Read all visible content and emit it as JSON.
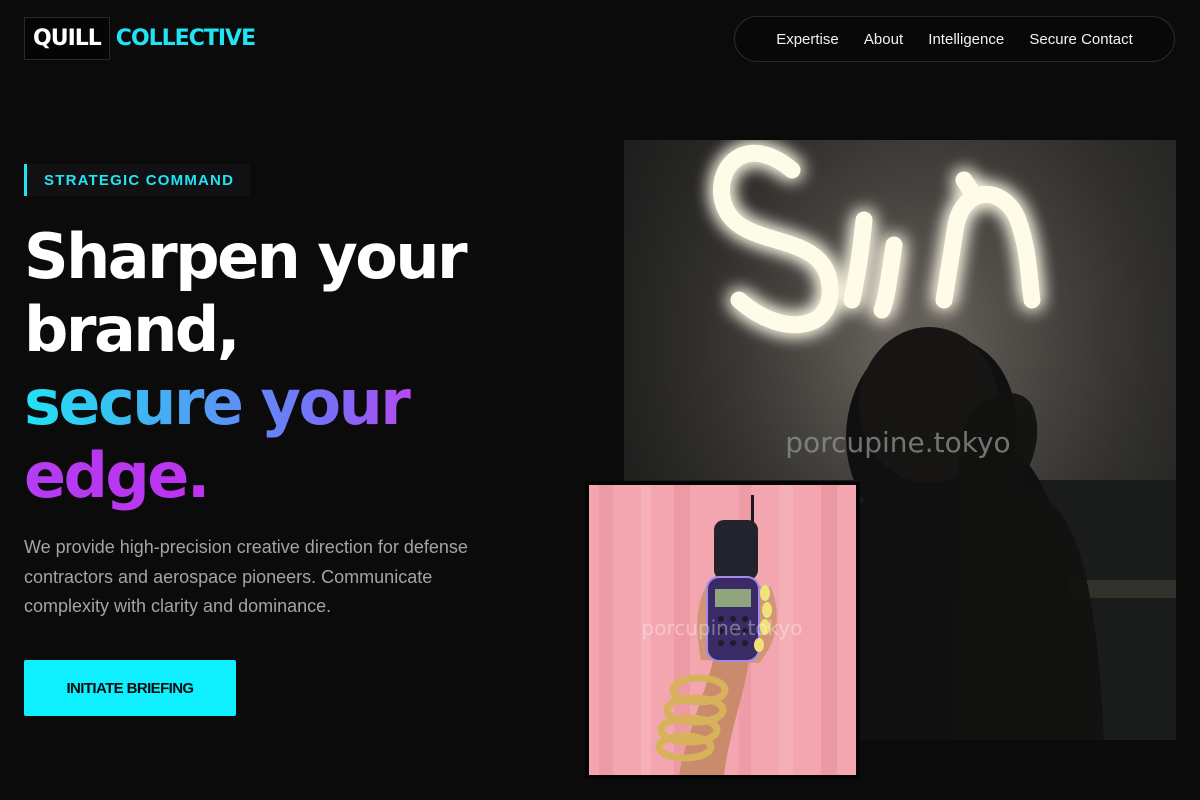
{
  "brand": {
    "box_word": "QUILL",
    "accent_word": "COLLECTIVE",
    "accent_color": "#22e3f2"
  },
  "nav": {
    "items": [
      "Expertise",
      "About",
      "Intelligence",
      "Secure Contact"
    ]
  },
  "hero": {
    "tag": "STRATEGIC COMMAND",
    "headline": {
      "line1": "Sharpen your",
      "line2": "brand,",
      "line3": "secure your",
      "line4": "edge."
    },
    "description": "We provide high-precision creative direction for defense contractors and aerospace pioneers. Communicate complexity with clarity and dominance.",
    "cta_label": "INITIATE BRIEFING",
    "cta_color": "#0ef0ff"
  },
  "images": {
    "main": {
      "sign_text": "Sin",
      "watermark": "porcupine.tokyo"
    },
    "inset": {
      "watermark": "porcupine.tokyo"
    }
  }
}
